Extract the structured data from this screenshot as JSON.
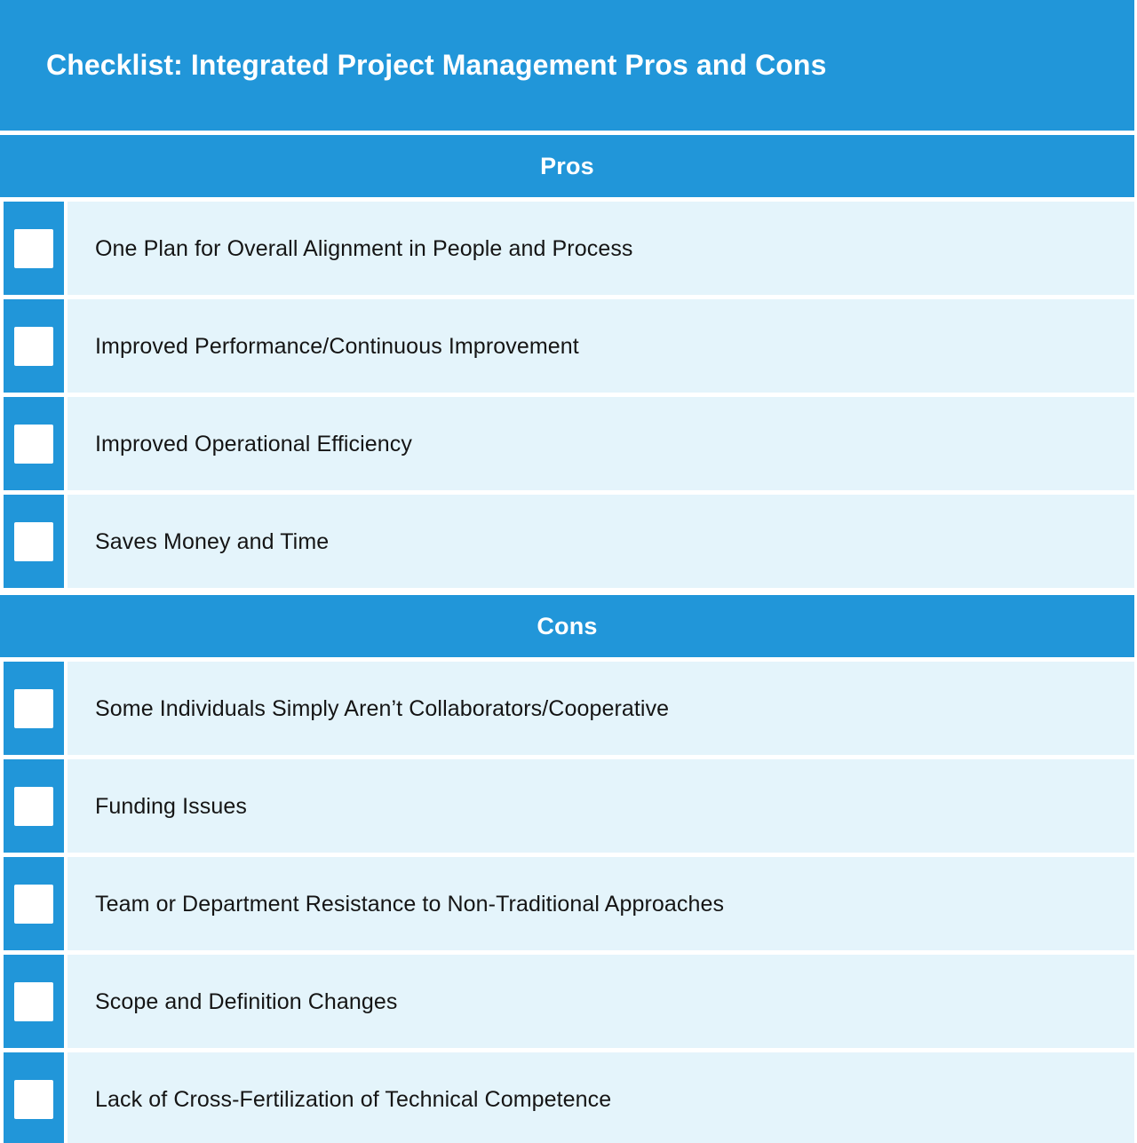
{
  "title": "Checklist: Integrated Project Management Pros and Cons",
  "colors": {
    "header_blue": "#2196d9",
    "row_light_blue": "#e4f4fb",
    "checkbox_white": "#ffffff",
    "text_dark": "#151515",
    "page_background": "#ffffff"
  },
  "sections": [
    {
      "heading": "Pros",
      "items": [
        {
          "label": "One Plan for Overall Alignment in People and Process",
          "checked": false
        },
        {
          "label": "Improved Performance/Continuous Improvement",
          "checked": false
        },
        {
          "label": "Improved Operational Efficiency",
          "checked": false
        },
        {
          "label": "Saves Money and Time",
          "checked": false
        }
      ]
    },
    {
      "heading": "Cons",
      "items": [
        {
          "label": "Some Individuals Simply Aren’t Collaborators/Cooperative",
          "checked": false
        },
        {
          "label": "Funding Issues",
          "checked": false
        },
        {
          "label": "Team or Department Resistance to Non-Traditional Approaches",
          "checked": false
        },
        {
          "label": "Scope and Definition Changes",
          "checked": false
        },
        {
          "label": "Lack of Cross-Fertilization of Technical Competence",
          "checked": false
        }
      ]
    }
  ]
}
